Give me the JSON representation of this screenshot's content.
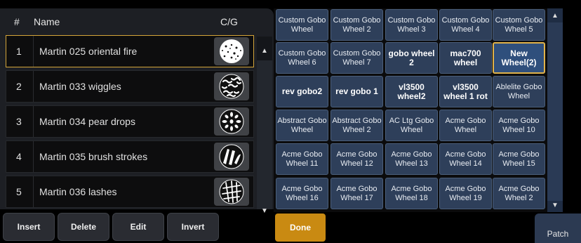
{
  "list": {
    "headers": {
      "num": "#",
      "name": "Name",
      "cg": "C/G"
    },
    "rows": [
      {
        "num": "1",
        "name": "Martin 025 oriental fire",
        "gobo": "oriental-fire-gobo-icon"
      },
      {
        "num": "2",
        "name": "Martin 033 wiggles",
        "gobo": "wiggles-gobo-icon"
      },
      {
        "num": "3",
        "name": "Martin 034 pear drops",
        "gobo": "pear-drops-gobo-icon"
      },
      {
        "num": "4",
        "name": "Martin 035 brush strokes",
        "gobo": "brush-strokes-gobo-icon"
      },
      {
        "num": "5",
        "name": "Martin 036 lashes",
        "gobo": "lashes-gobo-icon"
      }
    ]
  },
  "buttons": {
    "insert": "Insert",
    "delete": "Delete",
    "edit": "Edit",
    "invert": "Invert",
    "done": "Done",
    "patch": "Patch"
  },
  "scroll": {
    "up": "▲",
    "down": "▼"
  },
  "wheels": [
    [
      "Custom Gobo Wheel",
      "Custom Gobo Wheel 2",
      "Custom Gobo Wheel 3",
      "Custom Gobo Wheel 4",
      "Custom Gobo Wheel 5"
    ],
    [
      "Custom Gobo Wheel 6",
      "Custom Gobo Wheel 7",
      "gobo wheel 2",
      "mac700 wheel",
      "New Wheel(2)"
    ],
    [
      "rev gobo2",
      "rev gobo 1",
      "vl3500 wheel2",
      "vl3500 wheel 1 rot",
      "Ablelite Gobo Wheel"
    ],
    [
      "Abstract Gobo Wheel",
      "Abstract Gobo Wheel 2",
      "AC Ltg Gobo Wheel",
      "Acme Gobo Wheel",
      "Acme Gobo Wheel 10"
    ],
    [
      "Acme Gobo Wheel 11",
      "Acme Gobo Wheel 12",
      "Acme Gobo Wheel 13",
      "Acme Gobo Wheel 14",
      "Acme Gobo Wheel 15"
    ],
    [
      "Acme Gobo Wheel 16",
      "Acme Gobo Wheel 17",
      "Acme Gobo Wheel 18",
      "Acme Gobo Wheel 19",
      "Acme Gobo Wheel 2"
    ]
  ],
  "colors": {
    "accent": "#c98a12",
    "selection": "#d4a53a",
    "cell": "#2e3f5a"
  }
}
